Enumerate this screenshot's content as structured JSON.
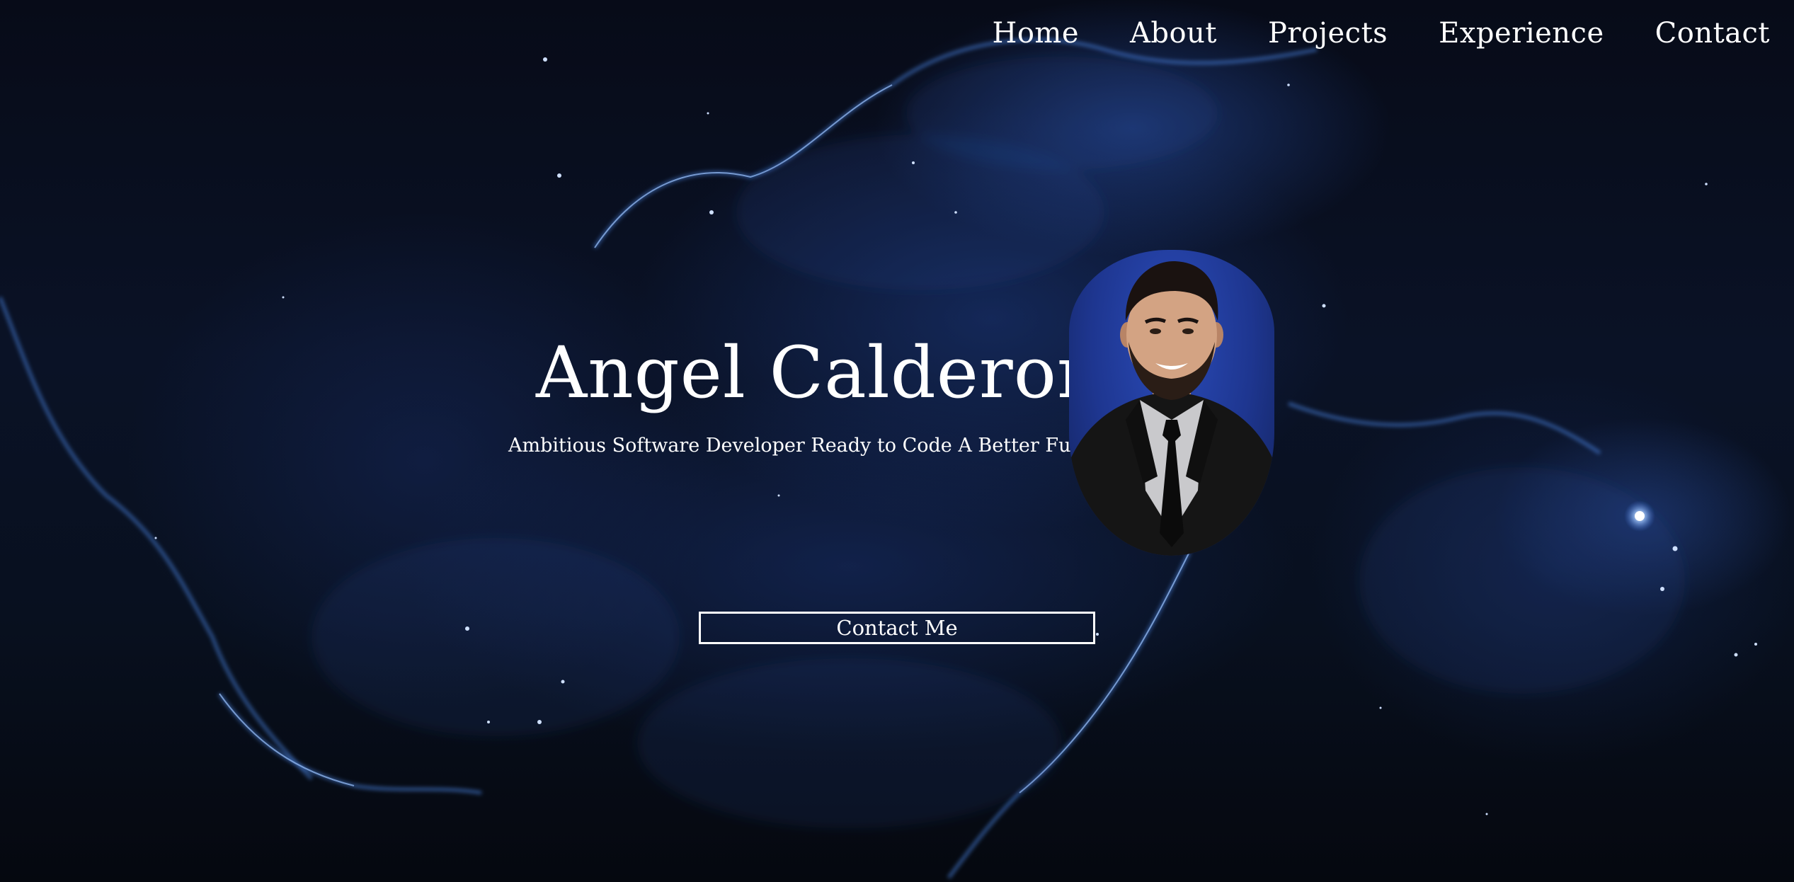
{
  "nav": {
    "items": [
      {
        "label": "Home"
      },
      {
        "label": "About"
      },
      {
        "label": "Projects"
      },
      {
        "label": "Experience"
      },
      {
        "label": "Contact"
      }
    ]
  },
  "hero": {
    "name": "Angel Calderon",
    "tagline": "Ambitious Software Developer Ready to Code A Better Future!",
    "button_label": "Contact Me"
  },
  "colors": {
    "background": "#0a1226",
    "accent": "#1e3690",
    "text": "#ffffff"
  }
}
